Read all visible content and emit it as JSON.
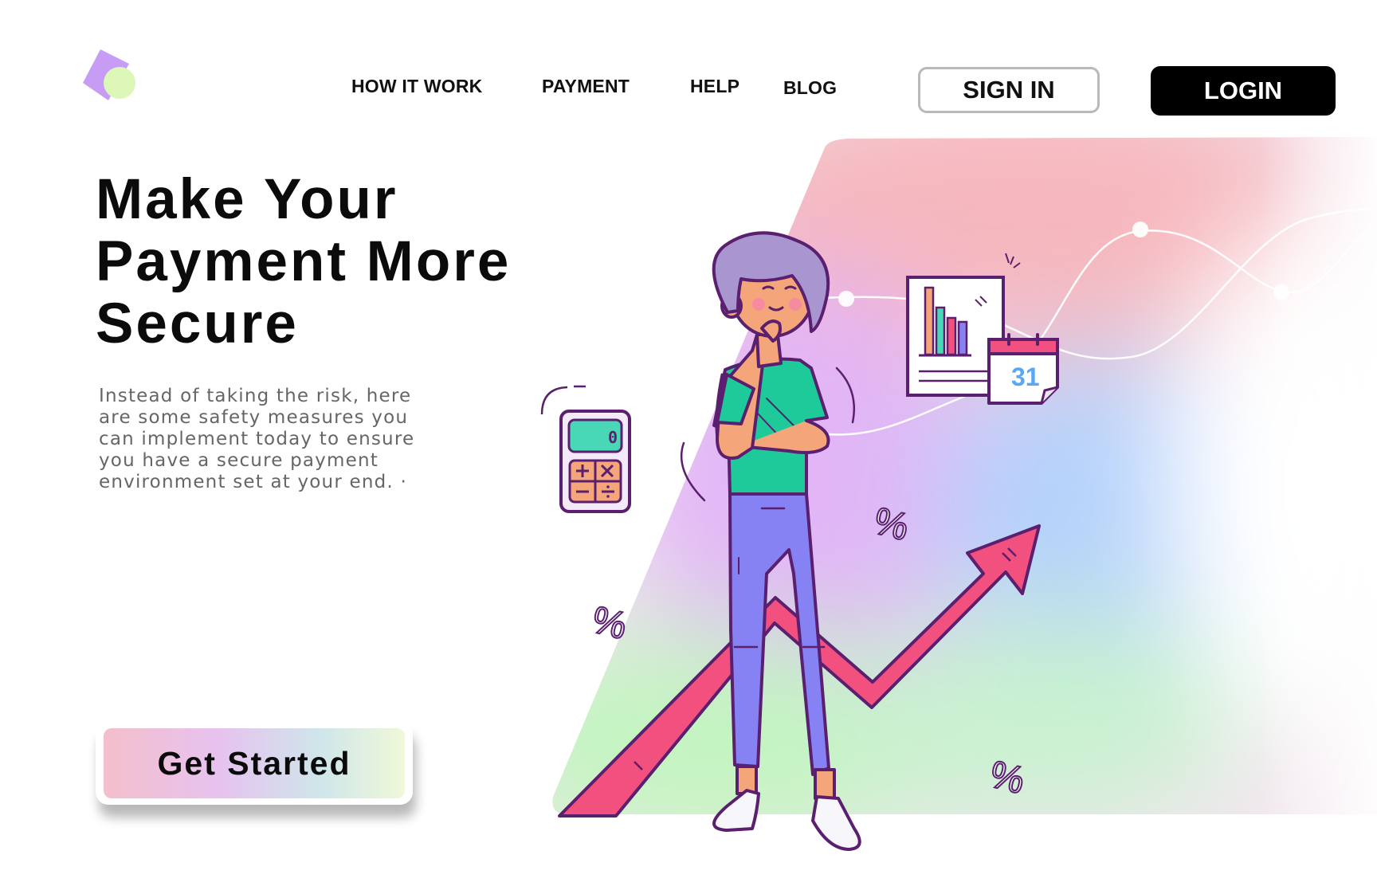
{
  "nav": {
    "links": [
      {
        "label": "HOW IT WORK"
      },
      {
        "label": "PAYMENT"
      },
      {
        "label": "HELP"
      },
      {
        "label": "BLOG"
      }
    ],
    "sign_in_label": "SIGN IN",
    "login_label": "LOGIN"
  },
  "hero": {
    "title": "Make Your Payment More Secure",
    "description": "Instead of taking the risk, here are some safety measures you can implement today to ensure you have a secure payment environment set at your end. ·",
    "cta_label": "Get Started"
  },
  "illustration": {
    "calculator_display": "0",
    "calendar_day": "31",
    "percent_symbol": "%"
  },
  "colors": {
    "logo_purple": "#c79cf5",
    "logo_green": "#dcf7b8",
    "arrow": "#f2507e",
    "shirt": "#1ec99a",
    "jeans": "#8782f4",
    "hair": "#a995cf",
    "outline": "#5a1f6e",
    "login_bg": "#000000"
  }
}
